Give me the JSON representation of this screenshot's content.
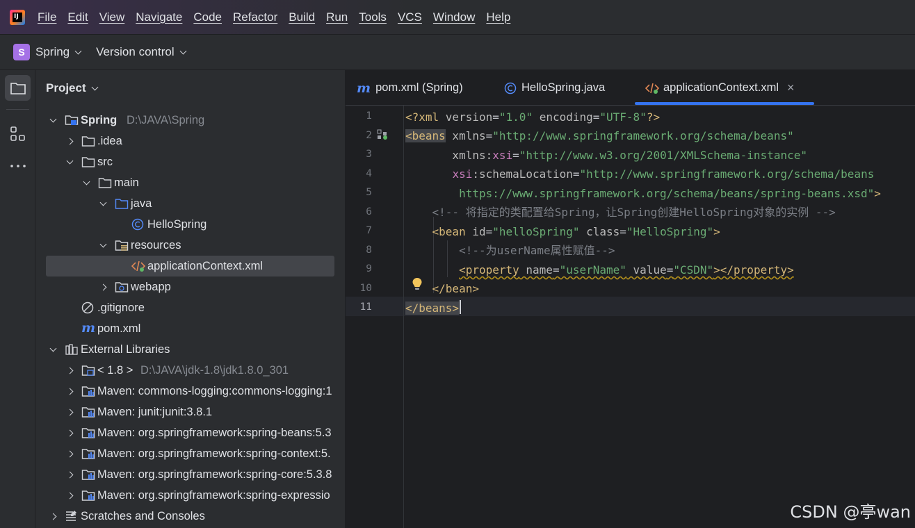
{
  "menu": [
    "File",
    "Edit",
    "View",
    "Navigate",
    "Code",
    "Refactor",
    "Build",
    "Run",
    "Tools",
    "VCS",
    "Window",
    "Help"
  ],
  "toolbar": {
    "project_badge": "S",
    "project_name": "Spring",
    "version_control": "Version control"
  },
  "panel": {
    "title": "Project"
  },
  "tree": [
    {
      "label": "Spring",
      "hint": "D:\\JAVA\\Spring",
      "icon": "module-folder-icon",
      "arrow": "down",
      "depth": 0
    },
    {
      "label": ".idea",
      "icon": "folder-icon",
      "arrow": "right",
      "depth": 1
    },
    {
      "label": "src",
      "icon": "folder-icon",
      "arrow": "down",
      "depth": 1
    },
    {
      "label": "main",
      "icon": "folder-icon",
      "arrow": "down",
      "depth": 2
    },
    {
      "label": "java",
      "icon": "source-folder-icon",
      "arrow": "down",
      "depth": 3
    },
    {
      "label": "HelloSpring",
      "icon": "java-class-icon",
      "arrow": "",
      "depth": 4
    },
    {
      "label": "resources",
      "icon": "resources-folder-icon",
      "arrow": "down",
      "depth": 3
    },
    {
      "label": "applicationContext.xml",
      "icon": "xml-file-icon",
      "arrow": "",
      "depth": 4,
      "selected": true
    },
    {
      "label": "webapp",
      "icon": "web-folder-icon",
      "arrow": "right",
      "depth": 3
    },
    {
      "label": ".gitignore",
      "icon": "ignore-file-icon",
      "arrow": "",
      "depth": 1
    },
    {
      "label": "pom.xml",
      "icon": "maven-icon",
      "arrow": "",
      "depth": 1
    },
    {
      "label": "External Libraries",
      "icon": "libraries-icon",
      "arrow": "down",
      "depth": 0
    },
    {
      "label": "< 1.8 >",
      "hint": "D:\\JAVA\\jdk-1.8\\jdk1.8.0_301",
      "icon": "jdk-icon",
      "arrow": "right",
      "depth": 1
    },
    {
      "label": "Maven: commons-logging:commons-logging:1",
      "icon": "library-icon",
      "arrow": "right",
      "depth": 1
    },
    {
      "label": "Maven: junit:junit:3.8.1",
      "icon": "library-icon",
      "arrow": "right",
      "depth": 1
    },
    {
      "label": "Maven: org.springframework:spring-beans:5.3",
      "icon": "library-icon",
      "arrow": "right",
      "depth": 1
    },
    {
      "label": "Maven: org.springframework:spring-context:5.",
      "icon": "library-icon",
      "arrow": "right",
      "depth": 1
    },
    {
      "label": "Maven: org.springframework:spring-core:5.3.8",
      "icon": "library-icon",
      "arrow": "right",
      "depth": 1
    },
    {
      "label": "Maven: org.springframework:spring-expressio",
      "icon": "library-icon",
      "arrow": "right",
      "depth": 1
    },
    {
      "label": "Scratches and Consoles",
      "icon": "scratches-icon",
      "arrow": "right",
      "depth": 0
    }
  ],
  "tabs": [
    {
      "label": "pom.xml (Spring)",
      "icon": "maven-icon"
    },
    {
      "label": "HelloSpring.java",
      "icon": "java-class-icon"
    },
    {
      "label": "applicationContext.xml",
      "icon": "xml-file-icon",
      "active": true,
      "close": "×"
    }
  ],
  "line_numbers": [
    "1",
    "2",
    "3",
    "4",
    "5",
    "6",
    "7",
    "8",
    "9",
    "10",
    "11"
  ],
  "code": {
    "l1": {
      "a": "<?xml ",
      "b": "version",
      "c": "=",
      "d": "\"1.0\"",
      "e": " ",
      "f": "encoding",
      "g": "=",
      "h": "\"UTF-8\"",
      "i": "?>"
    },
    "l2": {
      "a": "<beans",
      "b": " xmlns",
      "c": "=",
      "d": "\"http://www.springframework.org/schema/beans\""
    },
    "l3": {
      "a": "       xmlns:",
      "b": "xsi",
      "c": "=",
      "d": "\"http://www.w3.org/2001/XMLSchema-instance\""
    },
    "l4": {
      "a": "       ",
      "b": "xsi",
      "c": ":schemaLocation",
      "d": "=",
      "e": "\"http://www.springframework.org/schema/beans"
    },
    "l5": {
      "a": "        ",
      "b": "https://www.springframework.org/schema/beans/spring-beans.xsd\"",
      "c": ">"
    },
    "l6": {
      "a": "    ",
      "b": "<!-- 将指定的类配置给Spring，让Spring创建HelloSpring对象的实例 -->"
    },
    "l7": {
      "a": "    ",
      "b": "<bean ",
      "c": "id",
      "d": "=",
      "e": "\"helloSpring\"",
      "f": " class",
      "g": "=",
      "h": "\"HelloSpring\"",
      "i": ">"
    },
    "l8": {
      "a": "        ",
      "b": "<!--为userName属性赋值-->"
    },
    "l9": {
      "a": "        ",
      "b": "<property",
      "c": " name",
      "d": "=",
      "e": "\"userName\"",
      "f": " value",
      "g": "=",
      "h": "\"CSDN\"",
      "i": "></property>"
    },
    "l10": {
      "a": "    ",
      "b": "</bean>"
    },
    "l11": {
      "a": "</beans>"
    }
  },
  "watermark": "CSDN @亭wan"
}
